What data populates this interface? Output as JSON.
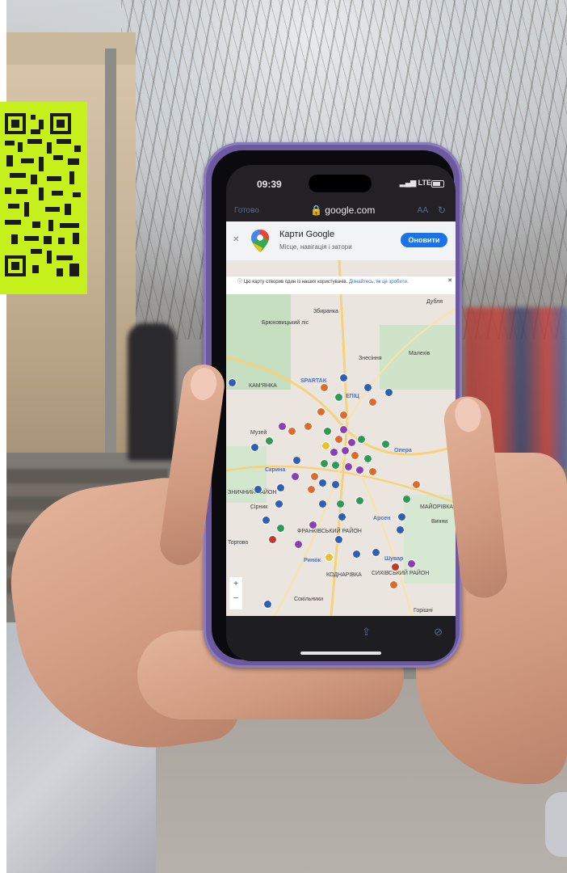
{
  "qr": {
    "color": "#c6f01b"
  },
  "phone": {
    "status_time": "09:39",
    "status_network": "LTE",
    "browser_done": "Готово",
    "browser_url": "google.com",
    "browser_aa": "AA",
    "app_banner": {
      "title": "Карти Google",
      "subtitle": "Місце, навігація і затори",
      "update_button": "Оновити"
    },
    "map_notice": {
      "text": "Цю карту створив один із наших користувачів.",
      "link": "Дізнайтесь, як це зробити."
    },
    "map_labels": [
      "Дубля",
      "Збиранка",
      "Брюховицький ліс",
      "Знесіння",
      "Малехів",
      "SPARTAK",
      "ЕПІЦ",
      "КАМ'ЯНКА",
      "Музей",
      "Опера",
      "Скрина",
      "Сірник",
      "ЗНИЧНИЙ РАЙОН",
      "Арсен",
      "Торгово",
      "ФРАНКІВСЬКИЙ РАЙОН",
      "Ринок",
      "Шувар",
      "СИХІВСЬКИЙ РАЙОН",
      "КОДНАРІВКА",
      "Сокільники",
      "Горішні",
      "Винни",
      "МАЙОРІВКА"
    ],
    "zoom_in": "+",
    "zoom_out": "−"
  }
}
